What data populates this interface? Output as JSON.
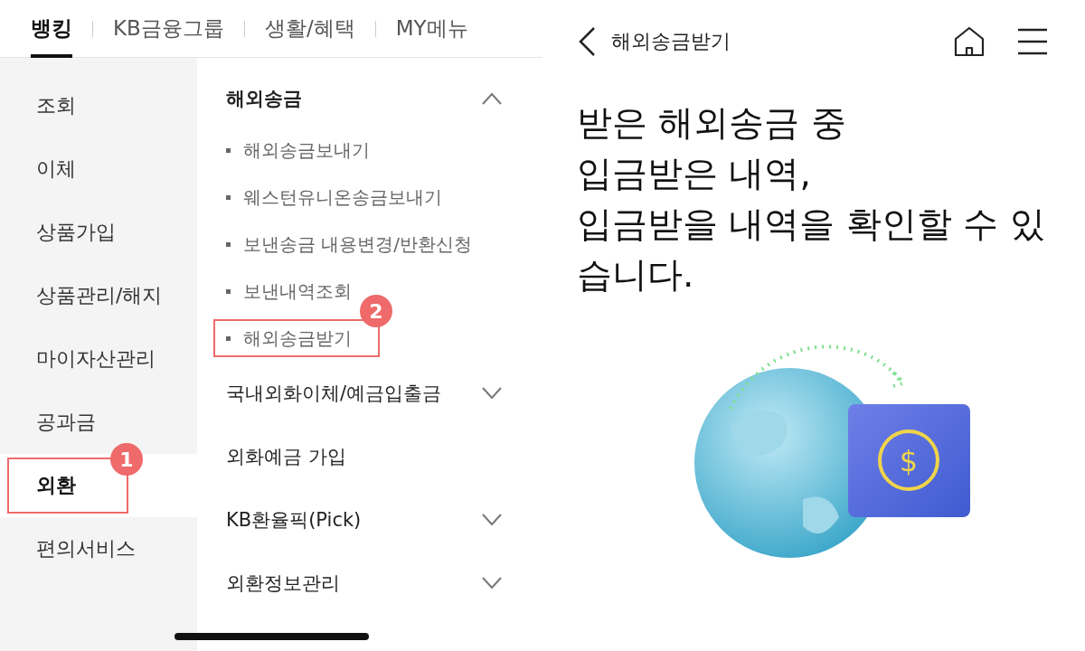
{
  "menu_screen": {
    "tabs": [
      {
        "label": "뱅킹",
        "selected": true
      },
      {
        "label": "KB금융그룹",
        "selected": false
      },
      {
        "label": "생활/혜택",
        "selected": false
      },
      {
        "label": "MY메뉴",
        "selected": false
      }
    ],
    "categories": [
      {
        "label": "조회",
        "selected": false
      },
      {
        "label": "이체",
        "selected": false
      },
      {
        "label": "상품가입",
        "selected": false
      },
      {
        "label": "상품관리/해지",
        "selected": false
      },
      {
        "label": "마이자산관리",
        "selected": false
      },
      {
        "label": "공과금",
        "selected": false
      },
      {
        "label": "외환",
        "selected": true,
        "annotation": "1"
      },
      {
        "label": "편의서비스",
        "selected": false
      }
    ],
    "submenu": [
      {
        "kind": "group",
        "label": "해외송금",
        "expanded": true,
        "children": [
          {
            "label": "해외송금보내기"
          },
          {
            "label": "웨스턴유니온송금보내기"
          },
          {
            "label": "보낸송금 내용변경/반환신청"
          },
          {
            "label": "보낸내역조회"
          },
          {
            "label": "해외송금받기",
            "annotation": "2"
          }
        ]
      },
      {
        "kind": "group",
        "label": "국내외화이체/예금입출금",
        "expanded": false
      },
      {
        "kind": "link",
        "label": "외화예금 가입"
      },
      {
        "kind": "group",
        "label": "KB환율픽(Pick)",
        "expanded": false
      },
      {
        "kind": "group",
        "label": "외환정보관리",
        "expanded": false
      }
    ]
  },
  "detail_screen": {
    "title": "해외송금받기",
    "heading_lines": [
      "받은 해외송금 중",
      "입금받은 내역,",
      "입금받을 내역을 확인할 수 있",
      "습니다."
    ],
    "currency_symbol": "$"
  }
}
